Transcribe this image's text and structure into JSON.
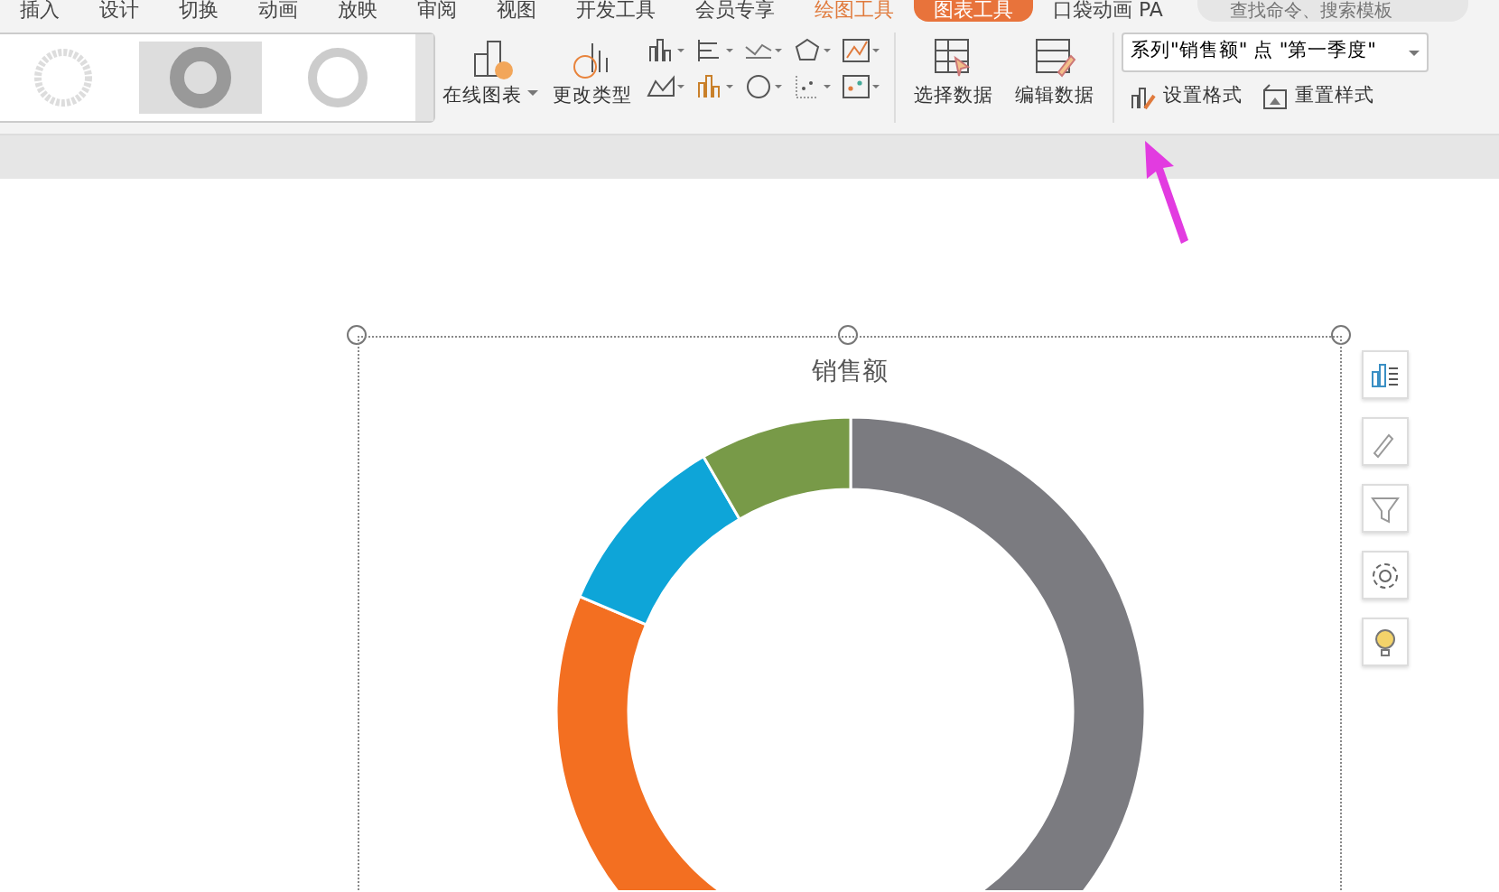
{
  "menu_tabs": [
    {
      "label": "插入",
      "selected": false,
      "kind": "plain"
    },
    {
      "label": "设计",
      "selected": false,
      "kind": "plain"
    },
    {
      "label": "切换",
      "selected": false,
      "kind": "plain"
    },
    {
      "label": "动画",
      "selected": false,
      "kind": "plain"
    },
    {
      "label": "放映",
      "selected": false,
      "kind": "plain"
    },
    {
      "label": "审阅",
      "selected": false,
      "kind": "plain"
    },
    {
      "label": "视图",
      "selected": false,
      "kind": "plain"
    },
    {
      "label": "开发工具",
      "selected": false,
      "kind": "plain"
    },
    {
      "label": "会员专享",
      "selected": false,
      "kind": "plain"
    },
    {
      "label": "绘图工具",
      "selected": false,
      "kind": "context"
    },
    {
      "label": "图表工具",
      "selected": true,
      "kind": "context"
    },
    {
      "label": "口袋动画 PA",
      "selected": false,
      "kind": "plain"
    }
  ],
  "search": {
    "placeholder": "查找命令、搜索模板"
  },
  "ribbon": {
    "big_buttons": [
      {
        "label": "在线图表",
        "dropdown": true
      },
      {
        "label": "更改类型",
        "dropdown": false
      }
    ],
    "data_buttons": [
      {
        "label": "选择数据"
      },
      {
        "label": "编辑数据"
      }
    ],
    "element_select": {
      "value": "系列\"销售额\" 点 \"第一季度\""
    },
    "format_buttons": [
      {
        "label": "设置格式"
      },
      {
        "label": "重置样式"
      }
    ]
  },
  "chart": {
    "title": "销售额"
  }
}
